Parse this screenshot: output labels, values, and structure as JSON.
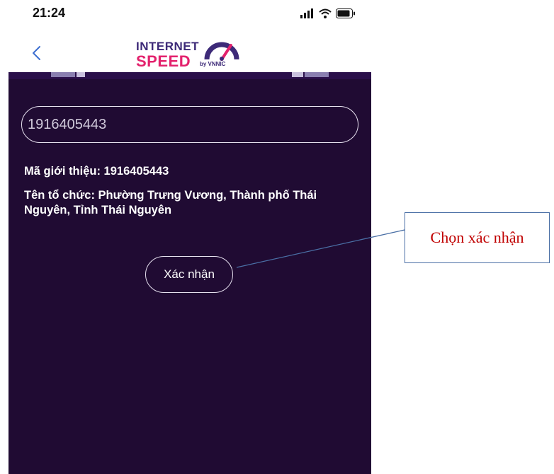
{
  "status_bar": {
    "time": "21:24"
  },
  "header": {
    "logo_top": "INTERNET",
    "logo_bottom": "SPEED",
    "logo_by": "by VNNIC"
  },
  "form": {
    "code_value": "1916405443",
    "referral_line": "Mã giới thiệu: 1916405443",
    "org_line": "Tên tổ chức: Phường Trưng Vương, Thành phố Thái Nguyên, Tỉnh Thái Nguyên",
    "confirm_label": "Xác nhận"
  },
  "annotation": {
    "callout_text": "Chọn xác nhận"
  },
  "colors": {
    "panel_background": "#200b33",
    "logo_purple": "#3d2a78",
    "logo_pink": "#e3226d",
    "callout_red": "#c00000",
    "callout_border": "#4a6fa5"
  },
  "icons": [
    "signal-icon",
    "wifi-icon",
    "battery-icon",
    "back-chevron-icon",
    "speed-gauge-icon"
  ]
}
